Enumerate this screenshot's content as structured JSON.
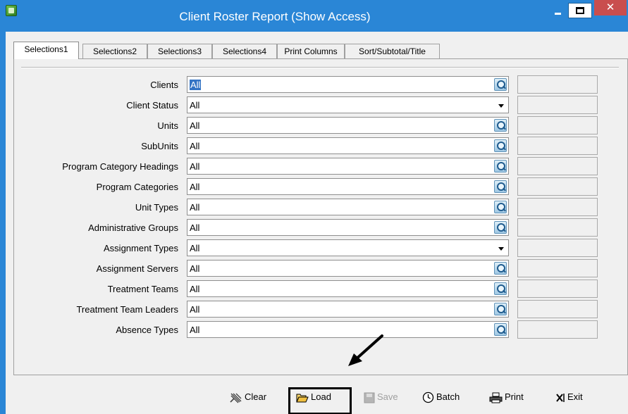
{
  "window": {
    "title": "Client Roster Report (Show Access)",
    "close_glyph": "✕"
  },
  "tabs": [
    {
      "label": "Selections1",
      "active": true
    },
    {
      "label": "Selections2",
      "active": false
    },
    {
      "label": "Selections3",
      "active": false
    },
    {
      "label": "Selections4",
      "active": false
    },
    {
      "label": "Print Columns",
      "active": false
    },
    {
      "label": "Sort/Subtotal/Title",
      "active": false
    }
  ],
  "fields": [
    {
      "label": "Clients",
      "value": "All",
      "control": "search",
      "selected": true
    },
    {
      "label": "Client Status",
      "value": "All",
      "control": "dropdown"
    },
    {
      "label": "Units",
      "value": "All",
      "control": "search"
    },
    {
      "label": "SubUnits",
      "value": "All",
      "control": "search"
    },
    {
      "label": "Program Category Headings",
      "value": "All",
      "control": "search"
    },
    {
      "label": "Program Categories",
      "value": "All",
      "control": "search"
    },
    {
      "label": "Unit Types",
      "value": "All",
      "control": "search"
    },
    {
      "label": "Administrative Groups",
      "value": "All",
      "control": "search"
    },
    {
      "label": "Assignment Types",
      "value": "All",
      "control": "dropdown"
    },
    {
      "label": "Assignment Servers",
      "value": "All",
      "control": "search"
    },
    {
      "label": "Treatment Teams",
      "value": "All",
      "control": "search"
    },
    {
      "label": "Treatment Team Leaders",
      "value": "All",
      "control": "search"
    },
    {
      "label": "Absence Types",
      "value": "All",
      "control": "search"
    }
  ],
  "buttons": {
    "clear": {
      "label": "Clear",
      "icon": "clear-icon"
    },
    "load": {
      "label": "Load",
      "icon": "folder-open-icon",
      "highlighted": true
    },
    "save": {
      "label": "Save",
      "icon": "floppy-icon",
      "disabled": true
    },
    "batch": {
      "label": "Batch",
      "icon": "clock-icon"
    },
    "print": {
      "label": "Print",
      "icon": "printer-icon"
    },
    "exit": {
      "label": "Exit",
      "icon": "exit-icon"
    }
  },
  "colors": {
    "titlebar": "#2a86d6",
    "close": "#c94e4e",
    "selection": "#3373c4"
  }
}
